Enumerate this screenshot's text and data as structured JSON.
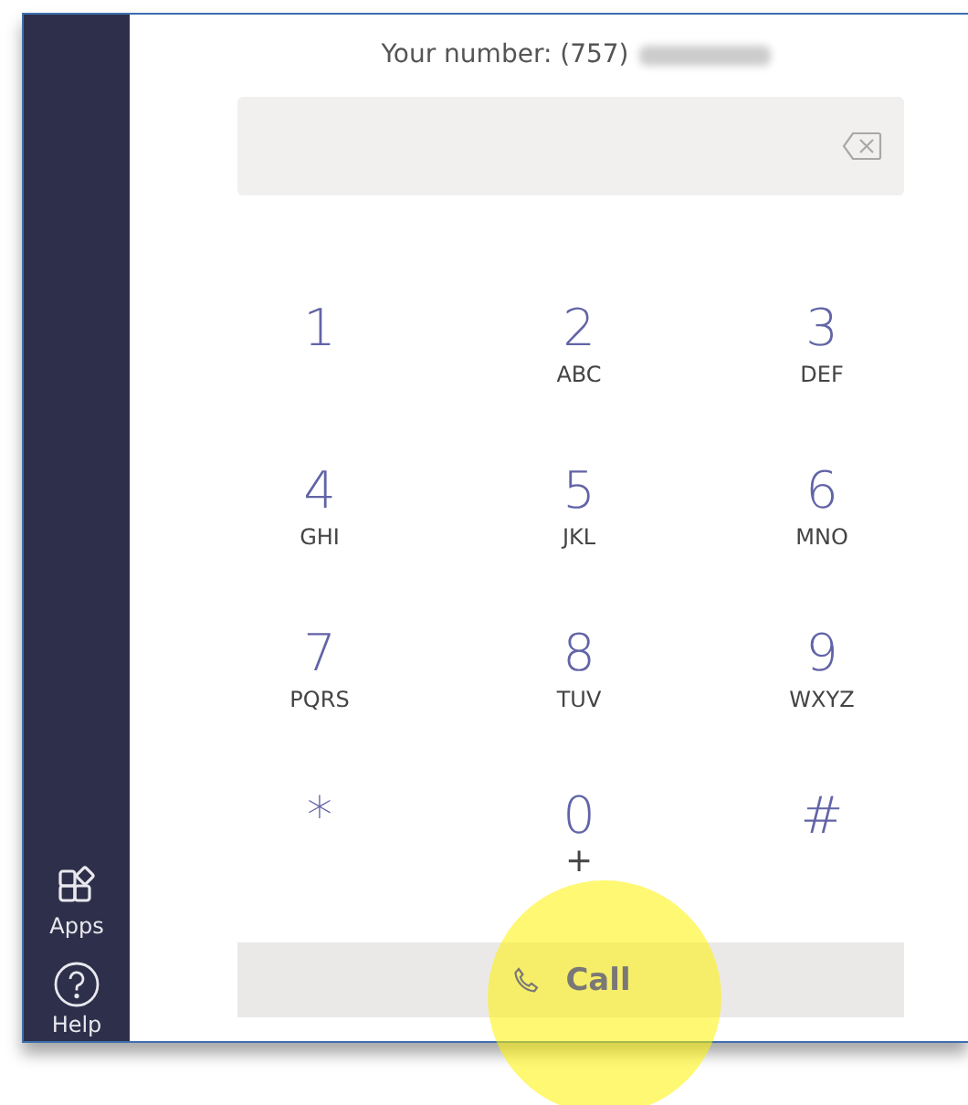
{
  "your_number": {
    "label": "Your number: (757)",
    "redacted": true
  },
  "keypad": [
    {
      "key": "1"
    },
    {
      "key": "2",
      "letters": "ABC"
    },
    {
      "key": "3",
      "letters": "DEF"
    },
    {
      "key": "4",
      "letters": "GHI"
    },
    {
      "key": "5",
      "letters": "JKL"
    },
    {
      "key": "6",
      "letters": "MNO"
    },
    {
      "key": "7",
      "letters": "PQRS"
    },
    {
      "key": "8",
      "letters": "TUV"
    },
    {
      "key": "9",
      "letters": "WXYZ"
    },
    {
      "key": "*"
    },
    {
      "key": "0",
      "letters": "+"
    },
    {
      "key": "#"
    }
  ],
  "call_button": {
    "label": "Call",
    "disabled": true
  },
  "sidebar": {
    "items": [
      {
        "kind": "apps",
        "label": "Apps"
      },
      {
        "kind": "help",
        "label": "Help"
      }
    ]
  },
  "highlight": true
}
